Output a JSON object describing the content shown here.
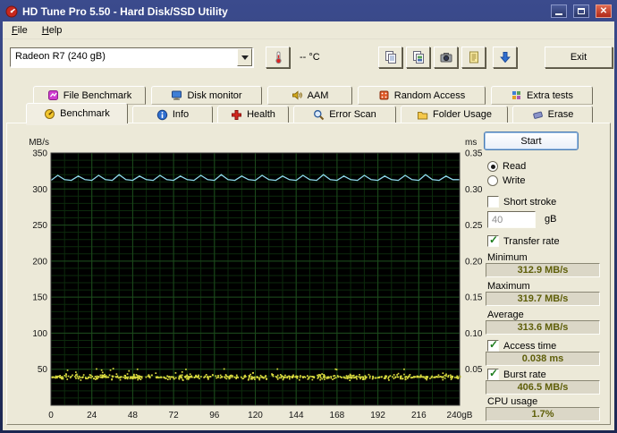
{
  "window": {
    "title": "HD Tune Pro 5.50 - Hard Disk/SSD Utility"
  },
  "glyphs": {
    "check": "✓",
    "close": "✕"
  },
  "menu": {
    "items": [
      {
        "label": "File"
      },
      {
        "label": "Help"
      }
    ]
  },
  "toolbar": {
    "drive_select": "Radeon R7 (240 gB)",
    "temperature": "-- °C",
    "exit": "Exit"
  },
  "tabs": {
    "row1": [
      {
        "label": "File Benchmark"
      },
      {
        "label": "Disk monitor"
      },
      {
        "label": "AAM"
      },
      {
        "label": "Random Access"
      },
      {
        "label": "Extra tests"
      }
    ],
    "row2": [
      {
        "label": "Benchmark",
        "active": true
      },
      {
        "label": "Info"
      },
      {
        "label": "Health"
      },
      {
        "label": "Error Scan"
      },
      {
        "label": "Folder Usage"
      },
      {
        "label": "Erase"
      }
    ]
  },
  "panel": {
    "start": "Start",
    "read": {
      "label": "Read",
      "selected": true
    },
    "write": {
      "label": "Write",
      "selected": false
    },
    "short_stroke": {
      "label": "Short stroke",
      "checked": false,
      "value": "40",
      "unit": "gB"
    },
    "transfer_rate": {
      "label": "Transfer rate",
      "checked": true,
      "minimum_label": "Minimum",
      "minimum": "312.9 MB/s",
      "maximum_label": "Maximum",
      "maximum": "319.7 MB/s",
      "average_label": "Average",
      "average": "313.6 MB/s"
    },
    "access_time": {
      "label": "Access time",
      "checked": true,
      "value": "0.038 ms"
    },
    "burst_rate": {
      "label": "Burst rate",
      "checked": true,
      "value": "406.5 MB/s"
    },
    "cpu_usage": {
      "label": "CPU usage",
      "value": "1.7%"
    }
  },
  "chart_data": {
    "type": "line",
    "title": "",
    "background": "#000000",
    "x_range": [
      0,
      240
    ],
    "x_unit": "gB",
    "x_ticks": {
      "values": [
        0,
        24,
        48,
        72,
        96,
        120,
        144,
        168,
        192,
        216,
        240
      ],
      "labels": [
        "0",
        "24",
        "48",
        "72",
        "96",
        "120",
        "144",
        "168",
        "192",
        "216",
        "240gB"
      ]
    },
    "left_axis": {
      "label": "MB/s",
      "range": [
        0,
        350
      ],
      "ticks": [
        50,
        100,
        150,
        200,
        250,
        300,
        350
      ]
    },
    "right_axis": {
      "label": "ms",
      "range": [
        0,
        0.35
      ],
      "ticks": [
        0.05,
        0.1,
        0.15,
        0.2,
        0.25,
        0.3,
        0.35
      ],
      "tick_labels": [
        "0.05",
        "0.10",
        "0.15",
        "0.20",
        "0.25",
        "0.30",
        "0.35"
      ]
    },
    "grid": {
      "minor_color": "#0c2a0c",
      "major_color": "#1c4a1c",
      "x_minor": 8,
      "y_minor": 10
    },
    "series": [
      {
        "name": "Transfer rate",
        "type": "line",
        "axis": "left",
        "unit": "MB/s",
        "color": "#8fd9ec",
        "x_step": 4,
        "values": [
          312,
          319,
          313,
          312,
          318,
          313,
          312,
          319,
          313,
          312,
          320,
          313,
          312,
          318,
          313,
          312,
          319,
          313,
          312,
          318,
          313,
          312,
          319,
          313,
          312,
          320,
          313,
          312,
          318,
          313,
          312,
          319,
          313,
          312,
          318,
          313,
          312,
          319,
          313,
          312,
          320,
          313,
          312,
          318,
          313,
          312,
          319,
          313,
          312,
          318,
          313,
          312,
          319,
          313,
          312,
          320,
          313,
          312,
          318,
          313,
          313
        ],
        "stats": {
          "minimum": 312.9,
          "maximum": 319.7,
          "average": 313.6
        }
      },
      {
        "name": "Access time",
        "type": "scatter",
        "axis": "right",
        "unit": "ms",
        "color": "#d9d93f",
        "band_center": 0.04,
        "band_spread": 0.005,
        "count": 620,
        "outlier_fraction": 0.05,
        "outlier_max": 0.052,
        "stats": {
          "average": 0.038
        }
      }
    ]
  }
}
